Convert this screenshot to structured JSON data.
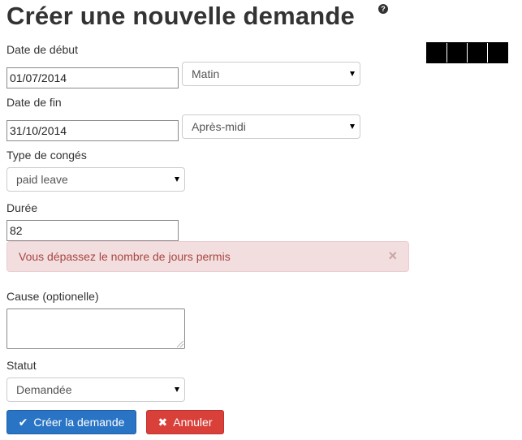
{
  "page": {
    "title": "Créer une nouvelle demande",
    "help_icon": "?"
  },
  "form": {
    "start_date": {
      "label": "Date de début",
      "value": "01/07/2014",
      "period": "Matin"
    },
    "end_date": {
      "label": "Date de fin",
      "value": "31/10/2014",
      "period": "Après-midi"
    },
    "leave_type": {
      "label": "Type de congés",
      "value": "paid leave"
    },
    "duration": {
      "label": "Durée",
      "value": "82"
    },
    "alert": {
      "message": "Vous dépassez le nombre de jours permis",
      "close": "×"
    },
    "cause": {
      "label": "Cause (optionelle)",
      "value": ""
    },
    "status": {
      "label": "Statut",
      "value": "Demandée"
    }
  },
  "actions": {
    "create_label": "Créer la demande",
    "create_icon": "✔",
    "cancel_label": "Annuler",
    "cancel_icon": "✖"
  },
  "colors": {
    "primary": "#2a74c5",
    "danger": "#d9403a",
    "alert_bg": "#f2dede",
    "alert_text": "#a94442"
  }
}
